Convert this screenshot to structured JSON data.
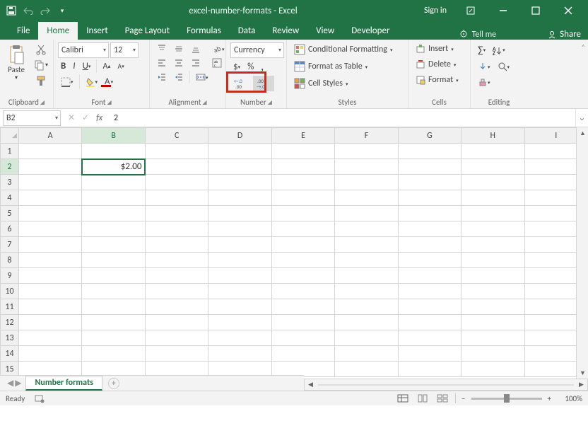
{
  "title": "excel-number-formats - Excel",
  "signin": "Sign in",
  "tabs": {
    "file": "File",
    "home": "Home",
    "insert": "Insert",
    "pageLayout": "Page Layout",
    "formulas": "Formulas",
    "data": "Data",
    "review": "Review",
    "view": "View",
    "developer": "Developer",
    "tellme": "Tell me",
    "share": "Share"
  },
  "ribbon": {
    "clipboard": {
      "label": "Clipboard",
      "paste": "Paste"
    },
    "font": {
      "label": "Font",
      "fontName": "Calibri",
      "fontSize": "12"
    },
    "alignment": {
      "label": "Alignment"
    },
    "number": {
      "label": "Number",
      "format": "Currency",
      "currency": "$",
      "percent": "%",
      "comma": ","
    },
    "styles": {
      "label": "Styles",
      "condFormat": "Conditional Formatting",
      "tableFormat": "Format as Table",
      "cellStyles": "Cell Styles"
    },
    "cells": {
      "label": "Cells",
      "insert": "Insert",
      "delete": "Delete",
      "format": "Format"
    },
    "editing": {
      "label": "Editing"
    }
  },
  "nameBox": "B2",
  "formula": "2",
  "columns": [
    "A",
    "B",
    "C",
    "D",
    "E",
    "F",
    "G",
    "H",
    "I"
  ],
  "rows": [
    "1",
    "2",
    "3",
    "4",
    "5",
    "6",
    "7",
    "8",
    "9",
    "10",
    "11",
    "12",
    "13",
    "14",
    "15"
  ],
  "cellB2": "$2.00",
  "sheetTab": "Number formats",
  "status": {
    "ready": "Ready",
    "zoom": "100%"
  }
}
